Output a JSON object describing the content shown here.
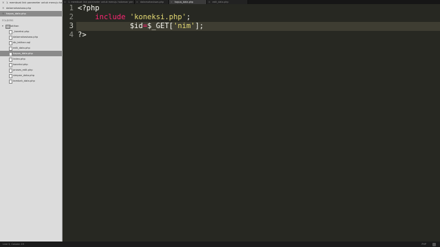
{
  "sidebar": {
    "open_files": [
      {
        "label": "1. membuat link parameter untuk menuju halaman yang dituju",
        "selected": false
      },
      {
        "label": "datamahasiswa.php",
        "selected": false
      },
      {
        "label": "hapus_data.php",
        "selected": true
      }
    ],
    "folders_header": "FOLDERS",
    "root_folder": "latihan",
    "files": [
      {
        "label": "_koneksi.php",
        "selected": false
      },
      {
        "label": "datamahasiswa.php",
        "selected": false
      },
      {
        "label": "db_latihan.sql",
        "selected": false
      },
      {
        "label": "edit_data.php",
        "selected": false
      },
      {
        "label": "hapus_data.php",
        "selected": true
      },
      {
        "label": "index.php",
        "selected": false
      },
      {
        "label": "koneksi.php",
        "selected": false
      },
      {
        "label": "proses_edit.php",
        "selected": false
      },
      {
        "label": "simpan_data.php",
        "selected": false
      },
      {
        "label": "tambah_data.php",
        "selected": false
      }
    ]
  },
  "tabs": [
    {
      "label": "1. membuat link parameter untuk menuju halaman yan",
      "active": false
    },
    {
      "label": "datamahasiswa.php",
      "active": false
    },
    {
      "label": "hapus_data.php",
      "active": true
    },
    {
      "label": "edit_data.php",
      "active": false
    }
  ],
  "editor": {
    "line_numbers": [
      "1",
      "2",
      "3",
      "4"
    ],
    "highlighted_line": 3,
    "lines": [
      {
        "indent": "",
        "tokens": [
          {
            "t": "<?php",
            "c": "plain"
          }
        ]
      },
      {
        "indent": "    ",
        "tokens": [
          {
            "t": "include",
            "c": "kw"
          },
          {
            "t": " ",
            "c": "plain"
          },
          {
            "t": "'koneksi.php'",
            "c": "str"
          },
          {
            "t": ";",
            "c": "plain"
          }
        ]
      },
      {
        "indent": "            ",
        "tokens": [
          {
            "t": "$id",
            "c": "var"
          },
          {
            "t": "=",
            "c": "kw"
          },
          {
            "t": "$_GET[",
            "c": "plain"
          },
          {
            "t": "'nim'",
            "c": "str"
          },
          {
            "t": "];",
            "c": "plain"
          }
        ]
      },
      {
        "indent": "",
        "tokens": [
          {
            "t": "?>",
            "c": "plain"
          }
        ]
      }
    ]
  },
  "status": {
    "left": "Line 3, Column 19",
    "right": "PHP"
  },
  "colors": {
    "editor_bg": "#272822",
    "keyword": "#f92672",
    "string": "#e6db74",
    "text": "#f8f8f2",
    "line_highlight": "#3e3d32"
  }
}
